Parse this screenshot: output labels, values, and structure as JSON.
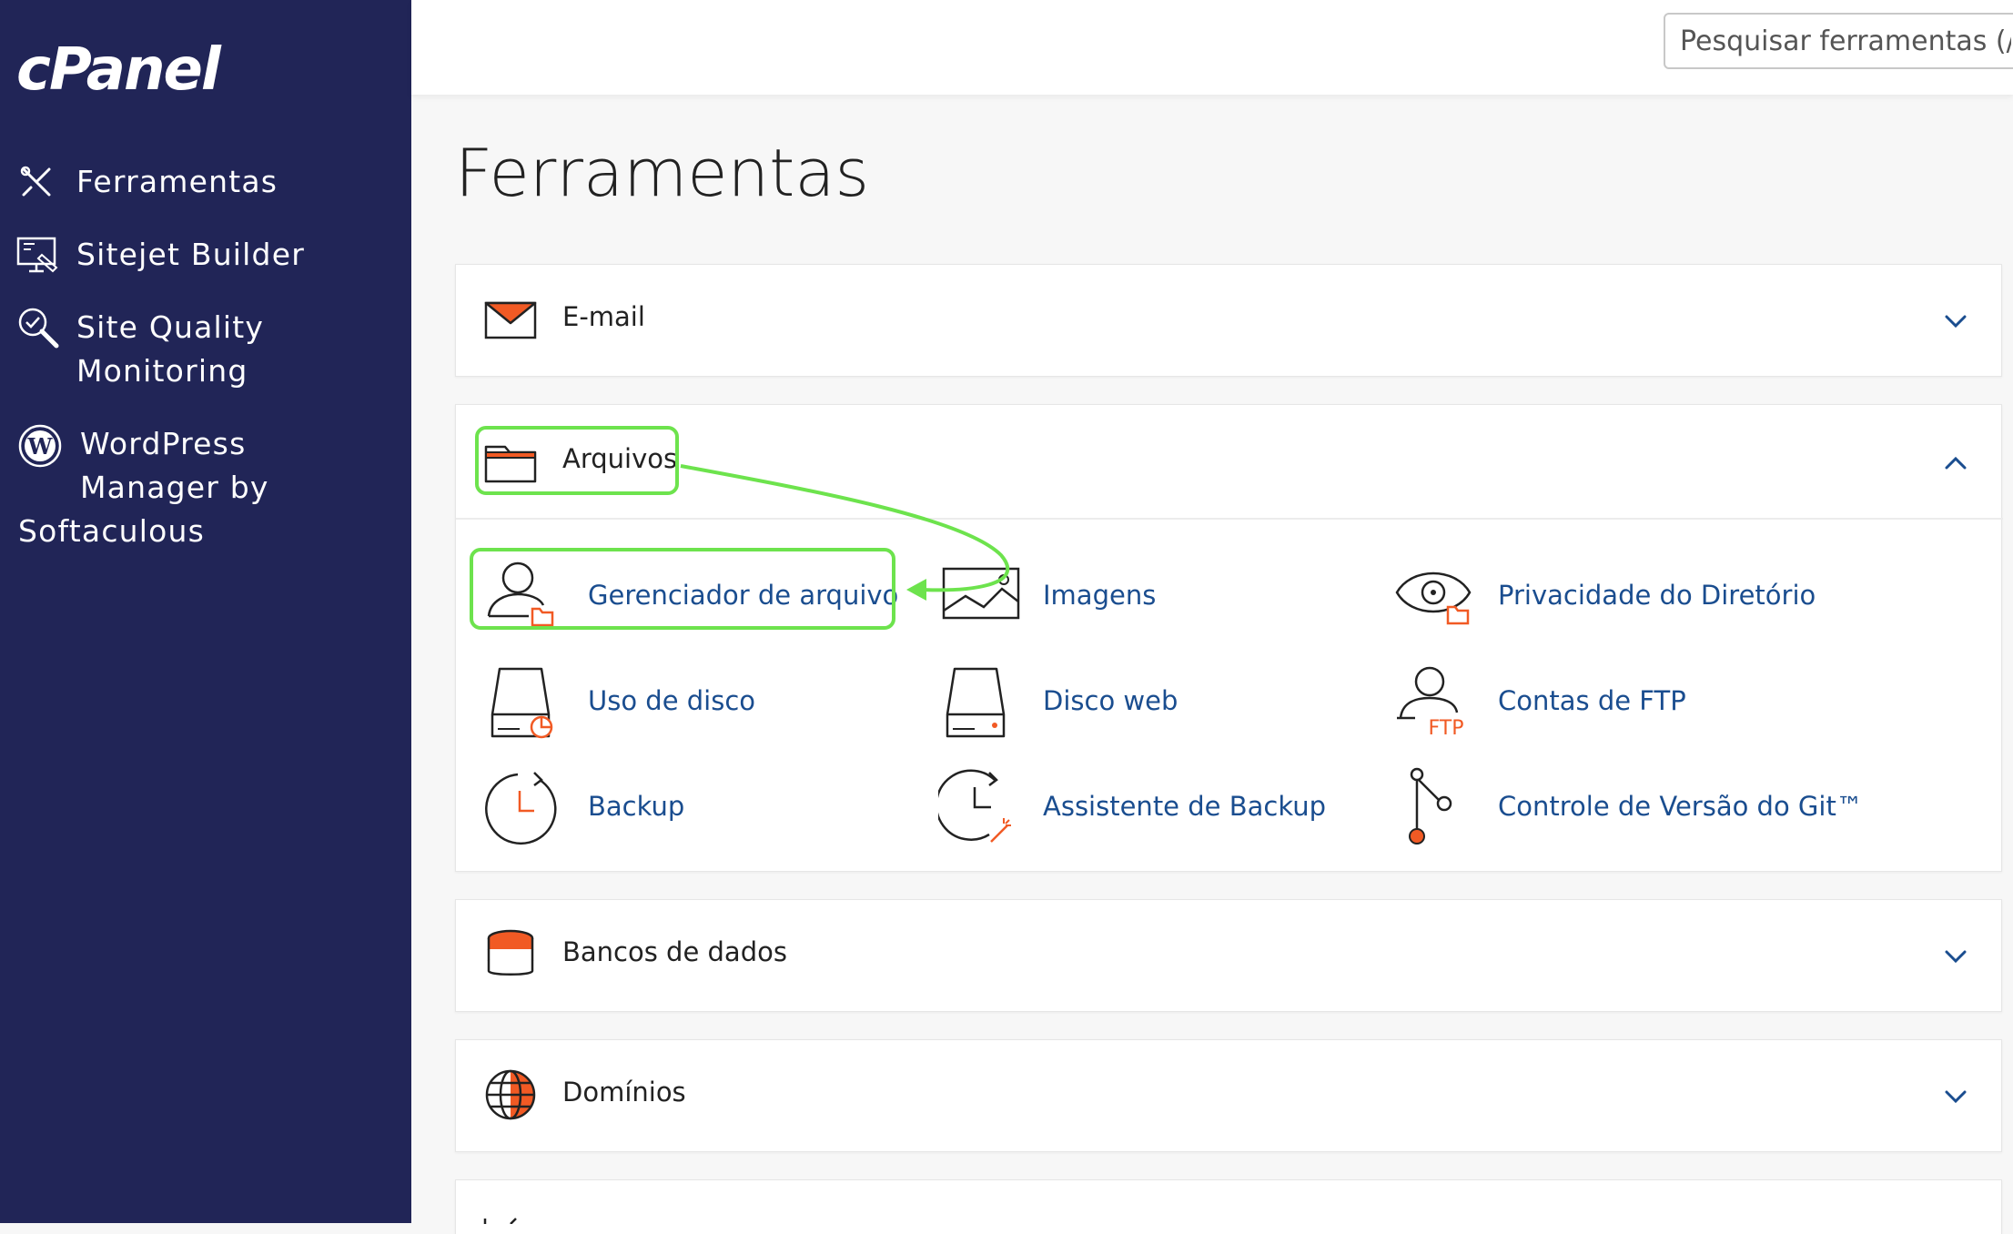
{
  "app": {
    "logo": "cPanel"
  },
  "sidebar": {
    "items": [
      {
        "label": "Ferramentas",
        "icon": "tools-icon"
      },
      {
        "label": "Sitejet Builder",
        "icon": "monitor-design-icon"
      },
      {
        "label": "Site Quality",
        "label2": "Monitoring",
        "icon": "magnifier-check-icon"
      },
      {
        "label": "WordPress",
        "label2": "Manager by",
        "label3": "Softaculous",
        "icon": "wordpress-icon"
      }
    ]
  },
  "search": {
    "placeholder": "Pesquisar ferramentas (/"
  },
  "main": {
    "title": "Ferramentas",
    "panels": [
      {
        "title": "E-mail",
        "icon": "envelope-icon",
        "state": "collapsed"
      },
      {
        "title": "Arquivos",
        "icon": "folder-icon",
        "state": "expanded",
        "tools": [
          {
            "label": "Gerenciador de arquivo",
            "icon": "file-manager-icon"
          },
          {
            "label": "Imagens",
            "icon": "image-icon"
          },
          {
            "label": "Privacidade do Diretório",
            "icon": "eye-icon"
          },
          {
            "label": "Uso de disco",
            "icon": "disk-usage-icon"
          },
          {
            "label": "Disco web",
            "icon": "web-disk-icon"
          },
          {
            "label": "Contas de FTP",
            "icon": "ftp-user-icon"
          },
          {
            "label": "Backup",
            "icon": "backup-icon"
          },
          {
            "label": "Assistente de Backup",
            "icon": "backup-wizard-icon"
          },
          {
            "label": "Controle de Versão do Git™",
            "icon": "git-icon"
          }
        ]
      },
      {
        "title": "Bancos de dados",
        "icon": "database-icon",
        "state": "collapsed"
      },
      {
        "title": "Domínios",
        "icon": "globe-icon",
        "state": "collapsed"
      }
    ]
  },
  "colors": {
    "sidebar_bg": "#212557",
    "accent_orange": "#f15a24",
    "link_blue": "#1a4d8f",
    "annotation_green": "#6de34d"
  }
}
